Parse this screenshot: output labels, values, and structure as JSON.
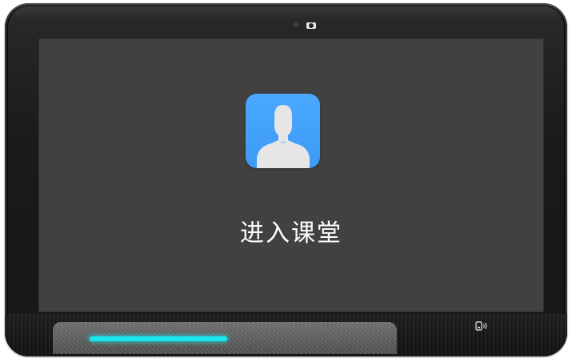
{
  "screen": {
    "enter_classroom_label": "进入课堂"
  },
  "icons": {
    "app_icon": "user-avatar-icon",
    "camera": "camera-icon",
    "sensor": "sensor-dot-icon",
    "nfc": "nfc-icon"
  },
  "colors": {
    "screen_background": "#414141",
    "app_icon_background": "#4aa8ff",
    "avatar_silhouette": "#e6e6e6",
    "led_bar": "#19e8f0",
    "label_text": "#ffffff"
  }
}
